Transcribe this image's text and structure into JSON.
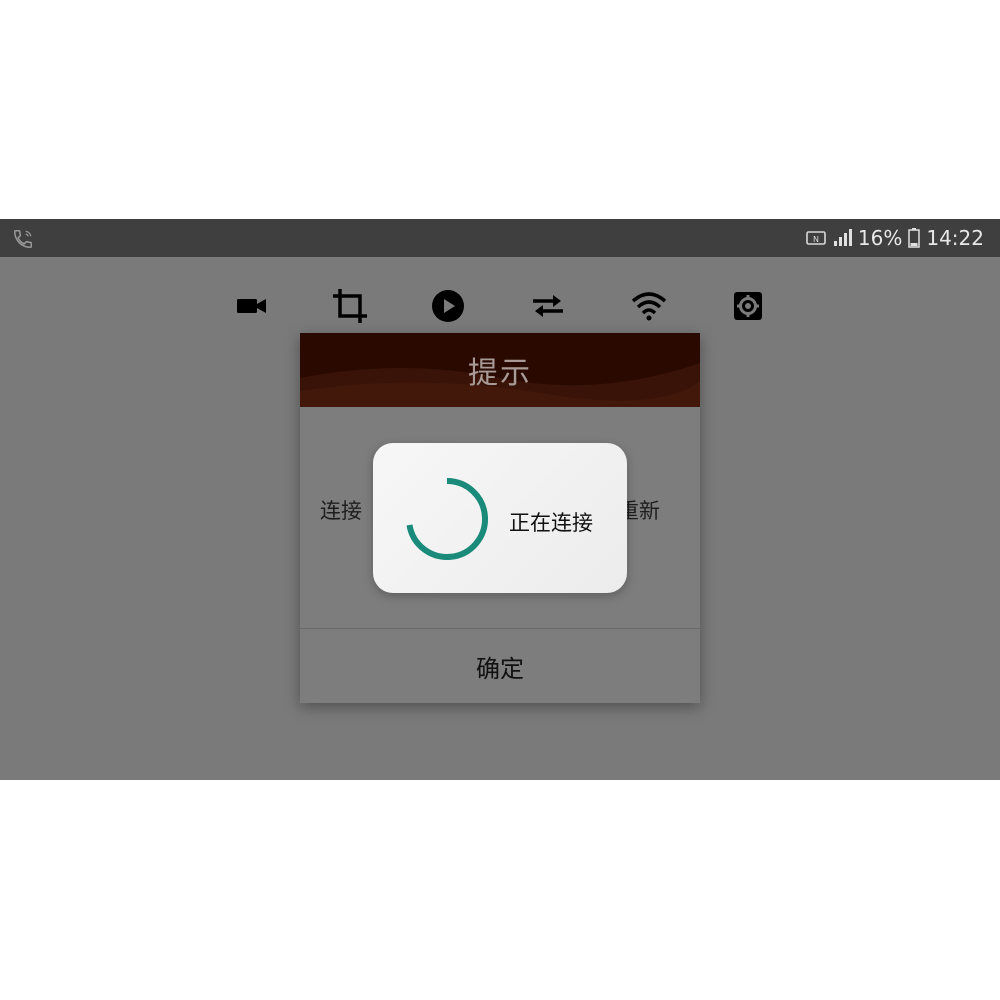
{
  "status_bar": {
    "battery": "16%",
    "time": "14:22",
    "icons": [
      "phone-call-icon",
      "nfc-icon",
      "signal-icon",
      "battery-icon"
    ]
  },
  "toolbar": {
    "icons": [
      "video-camera-icon",
      "crop-icon",
      "play-icon",
      "swap-icon",
      "wifi-icon",
      "settings-icon"
    ]
  },
  "alert": {
    "title": "提示",
    "message_visible_left": "连接",
    "message_visible_right": "重新",
    "ok_label": "确定",
    "header_color": "#2a0a00"
  },
  "progress": {
    "text": "正在连接",
    "spinner_color": "#1a8a7a"
  }
}
